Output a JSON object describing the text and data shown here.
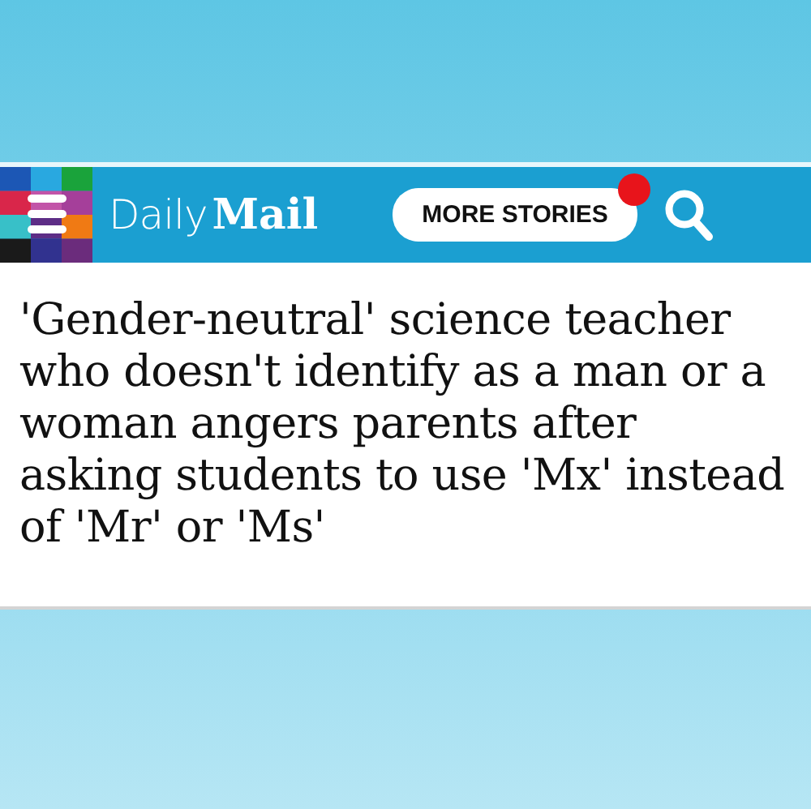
{
  "header": {
    "logo_prefix": "Daily",
    "logo_name": "Mail",
    "more_button": {
      "label": "MORE STORIES",
      "notification": true
    }
  },
  "headline": "'Gender-neutral' science teacher who doesn't identify as a man or a woman angers parents after asking students to use 'Mx' instead of 'Mr' or 'Ms'"
}
